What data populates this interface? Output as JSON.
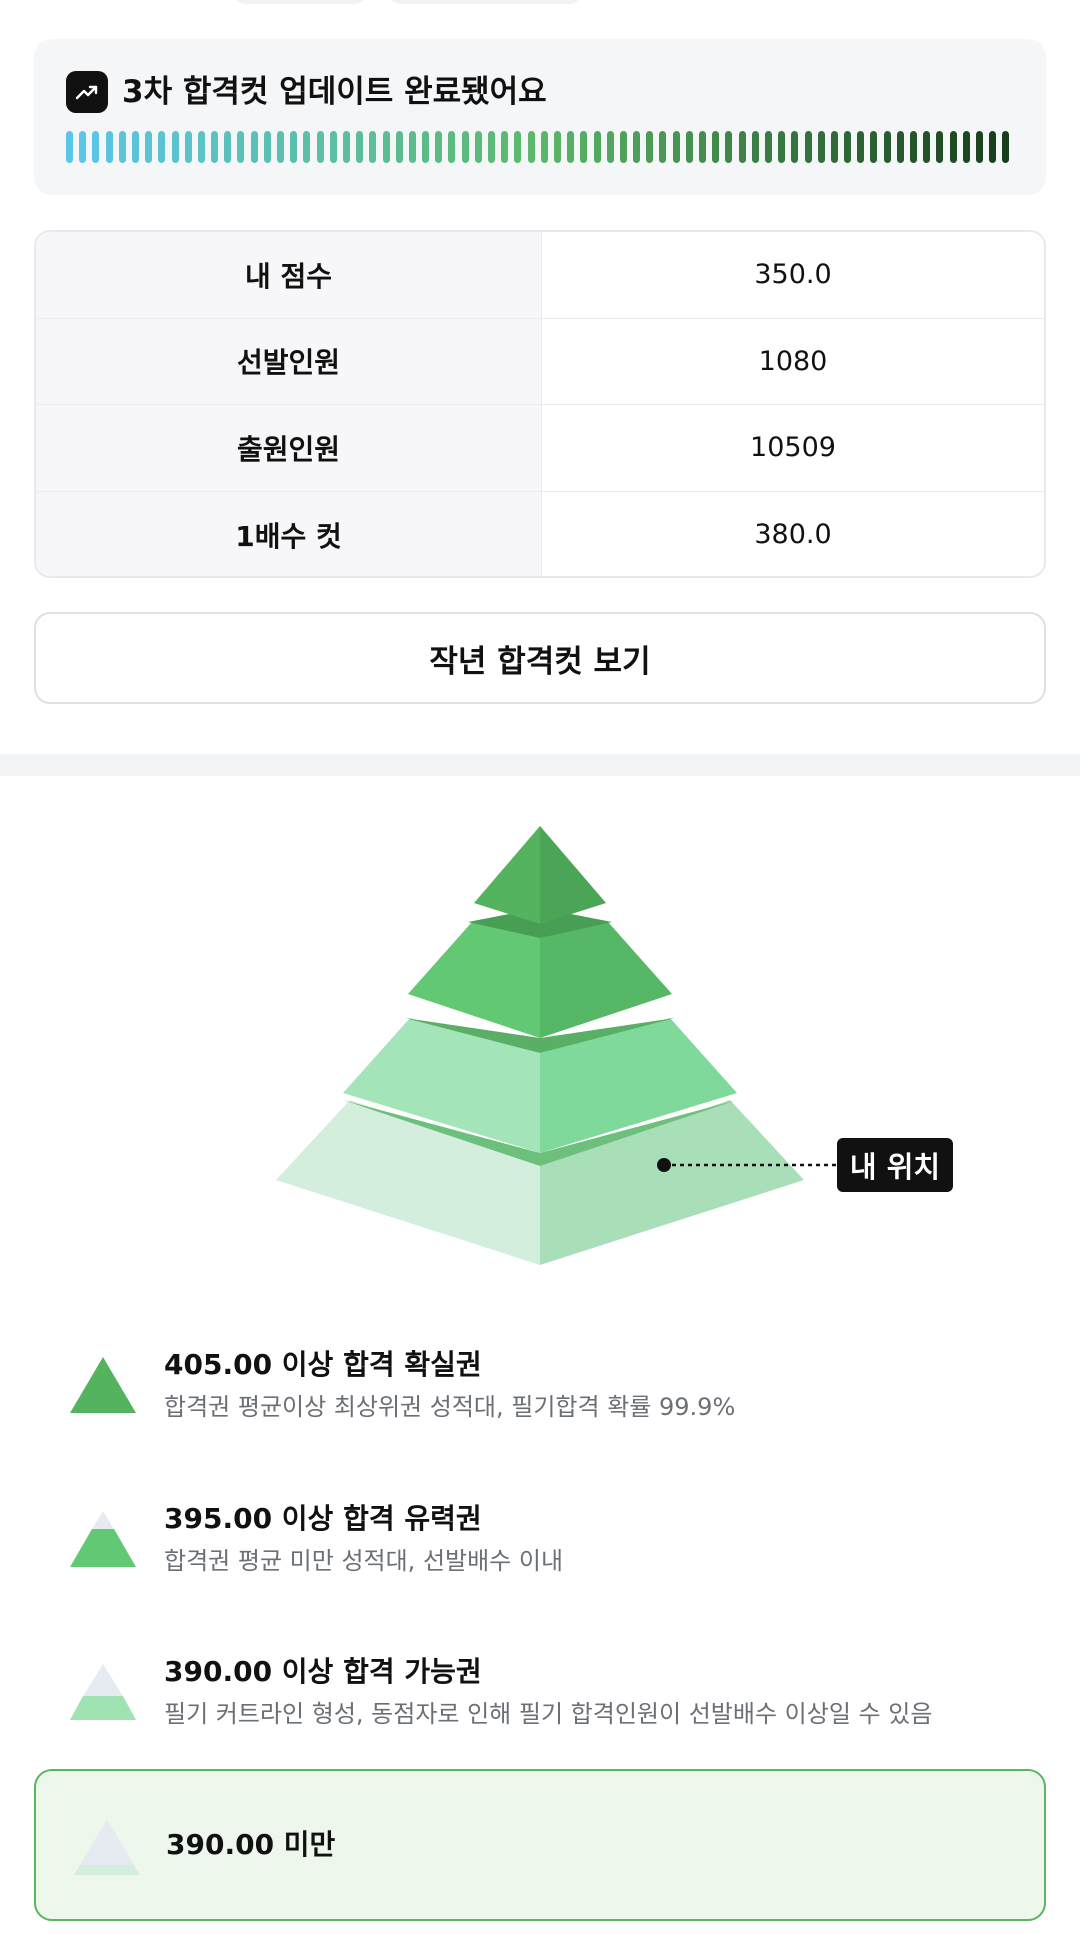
{
  "banner": {
    "icon": "trending-up-icon",
    "title": "3차 합격컷 업데이트 완료됐어요",
    "gradient_start": "#5bc6ea",
    "gradient_mid": "#5cb86a",
    "gradient_end": "#173d1c"
  },
  "table": {
    "rows": [
      {
        "label": "내 점수",
        "value": "350.0"
      },
      {
        "label": "선발인원",
        "value": "1080"
      },
      {
        "label": "출원인원",
        "value": "10509"
      },
      {
        "label": "1배수 컷",
        "value": "380.0"
      }
    ]
  },
  "last_year_button": "작년 합격컷 보기",
  "pyramid": {
    "my_position_label": "내 위치",
    "tier_colors": [
      "#54b35f",
      "#62c873",
      "#9fe3b3",
      "#cfeedc"
    ]
  },
  "legend": {
    "items": [
      {
        "title": "405.00 이상 합격 확실권",
        "desc": "합격권 평균이상 최상위권 성적대, 필기합격 확률 99.9%"
      },
      {
        "title": "395.00 이상 합격 유력권",
        "desc": "합격권 평균 미만 성적대, 선발배수 이내"
      },
      {
        "title": "390.00 이상 합격 가능권",
        "desc": "필기 커트라인 형성, 동점자로 인해 필기 합격인원이 선발배수 이상일 수 있음"
      }
    ],
    "selected": {
      "title": "390.00 미만"
    }
  }
}
